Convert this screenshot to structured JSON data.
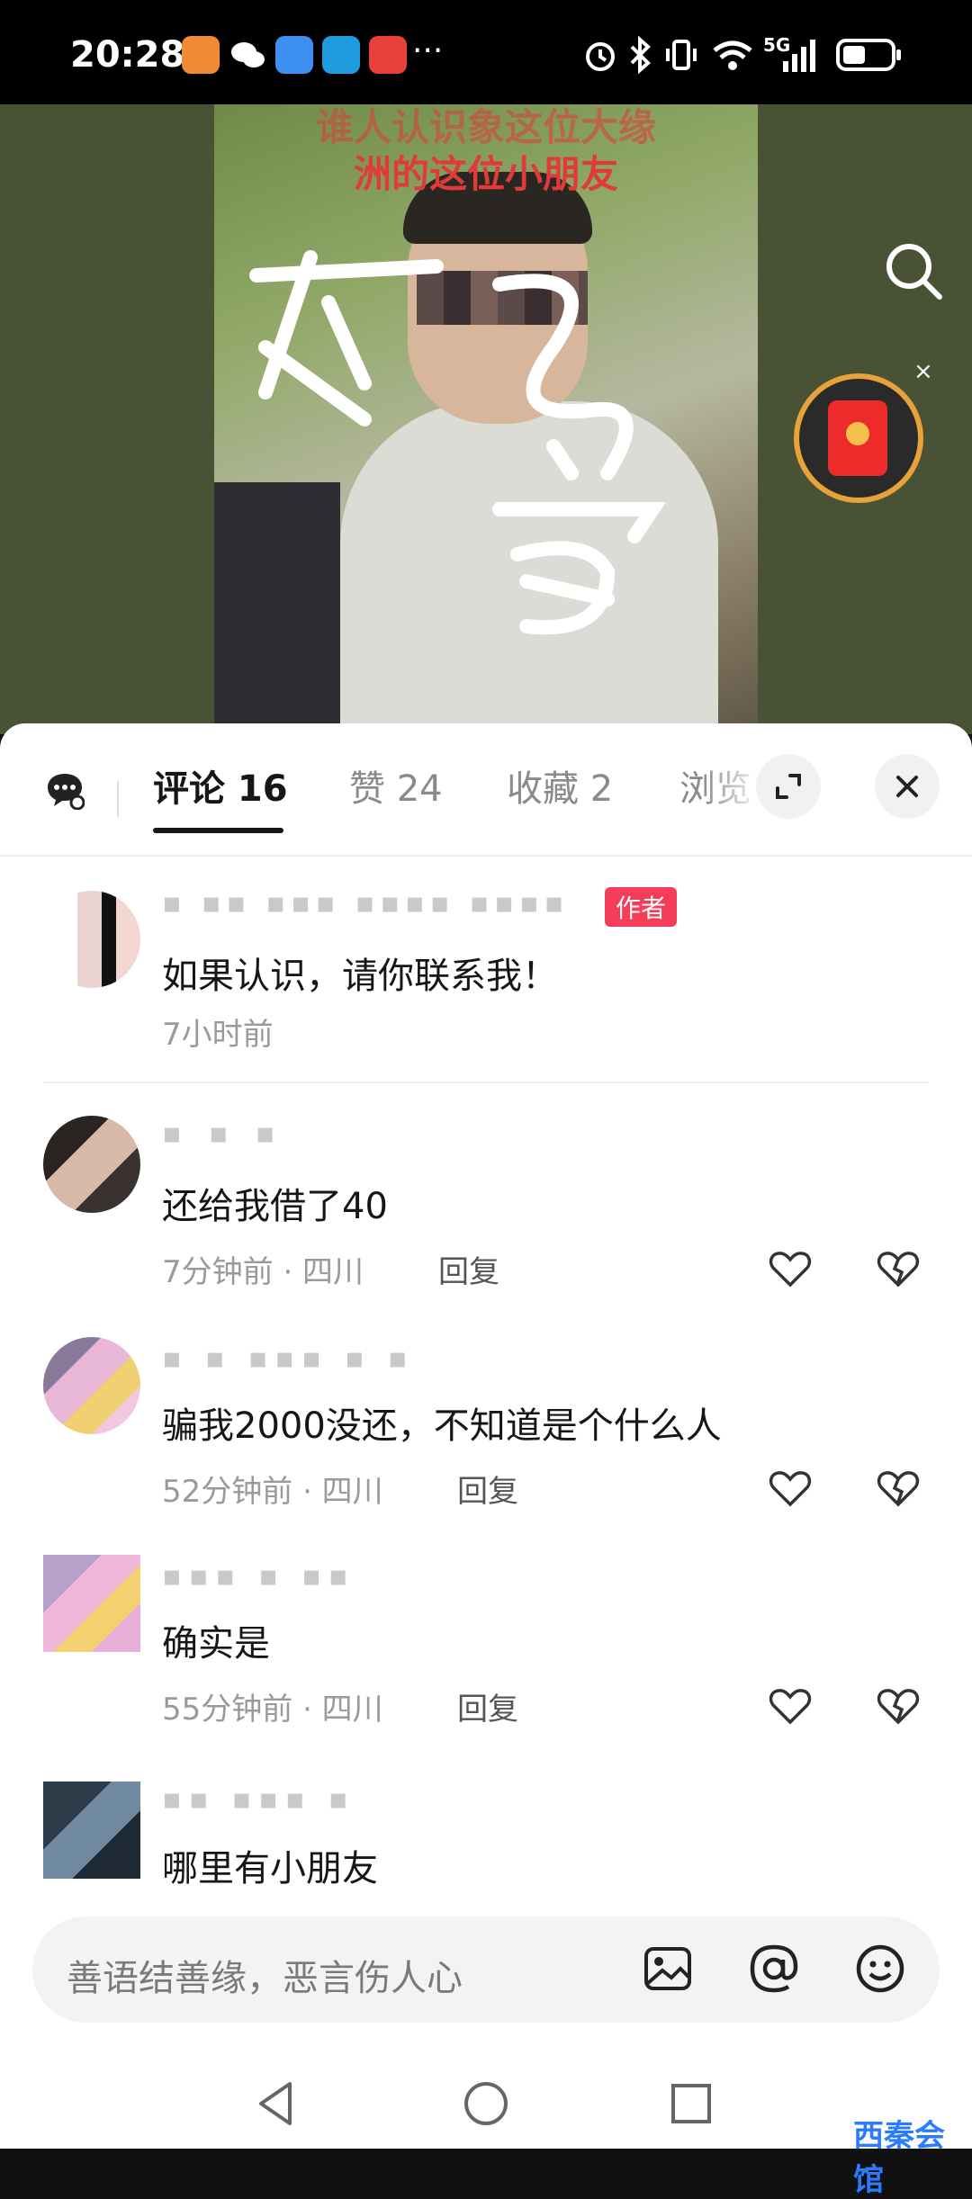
{
  "status_bar": {
    "time": "20:28",
    "more": "···",
    "network": "5G"
  },
  "video": {
    "caption_line1": "谁人认识象这位大缘",
    "caption_line2": "洲的这位小朋友",
    "search_icon": "search-icon",
    "red_packet_close": "×"
  },
  "tabs": [
    {
      "label": "评论 16",
      "active": true
    },
    {
      "label": "赞 24",
      "active": false
    },
    {
      "label": "收藏 2",
      "active": false
    },
    {
      "label": "浏览",
      "active": false
    }
  ],
  "comments": [
    {
      "text": "如果认识，请你联系我！",
      "meta": "7小时前",
      "badge": "作者",
      "is_author": true
    },
    {
      "text": "还给我借了40",
      "meta": "7分钟前 · 四川",
      "reply": "回复"
    },
    {
      "text": "骗我2000没还，不知道是个什么人",
      "meta": "52分钟前 · 四川",
      "reply": "回复"
    },
    {
      "text": "确实是",
      "meta": "55分钟前 · 四川",
      "reply": "回复"
    },
    {
      "text": "哪里有小朋友"
    }
  ],
  "input": {
    "placeholder": "善语结善缘，恶言伤人心",
    "icons": [
      "image-icon",
      "at-icon",
      "emoji-icon"
    ]
  },
  "navbar": {
    "icons": [
      "back-icon",
      "home-icon",
      "recents-icon"
    ]
  },
  "watermark": "西秦会馆",
  "colors": {
    "author_badge": "#f53c58",
    "video_bg": "#4a5236",
    "caption_red": "#e03a3a"
  }
}
